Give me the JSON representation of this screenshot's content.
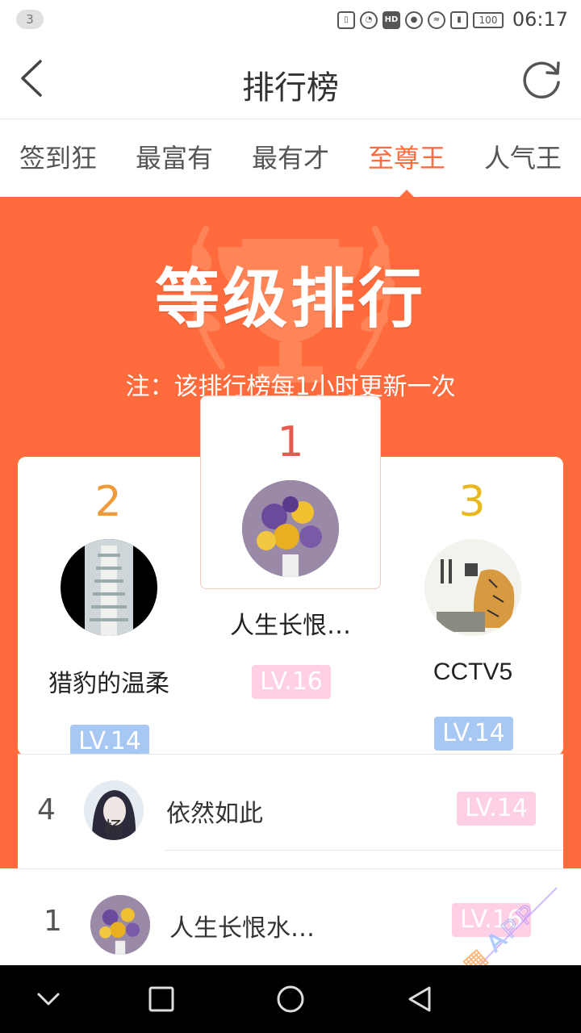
{
  "status": {
    "notif_count": "3",
    "battery": "100",
    "time": "06:17"
  },
  "header": {
    "title": "排行榜"
  },
  "tabs": [
    {
      "label": "签到狂",
      "active": false
    },
    {
      "label": "最富有",
      "active": false
    },
    {
      "label": "最有才",
      "active": false
    },
    {
      "label": "至尊王",
      "active": true
    },
    {
      "label": "人气王",
      "active": false
    }
  ],
  "banner": {
    "title": "等级排行",
    "note": "注：该排行榜每1小时更新一次"
  },
  "podium": {
    "first": {
      "rank": "1",
      "name": "人生长恨…",
      "level": "LV.16"
    },
    "second": {
      "rank": "2",
      "name": "猎豹的温柔",
      "level": "LV.14"
    },
    "third": {
      "rank": "3",
      "name": "CCTV5",
      "level": "LV.14"
    }
  },
  "list": [
    {
      "rank": "4",
      "name": "依然如此",
      "level": "LV.14",
      "avatar_char": "杨"
    }
  ],
  "my_rank": {
    "rank": "1",
    "name": "人生长恨水…",
    "level": "LV.16"
  },
  "colors": {
    "accent": "#ff6b3d",
    "rank1": "#e85a4f",
    "rank2": "#f09a3a",
    "rank3": "#e8b820",
    "lv_pink": "#ffcfe6",
    "lv_blue": "#a8c8f4"
  }
}
